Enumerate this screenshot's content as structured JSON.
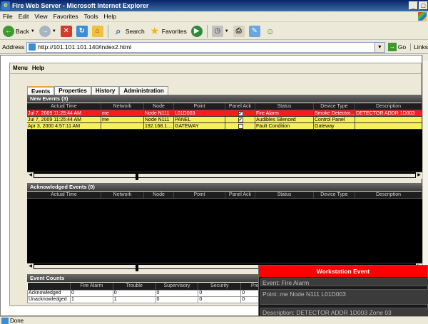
{
  "window": {
    "title": "Fire Web Server - Microsoft Internet Explorer",
    "controls": [
      "_",
      "□"
    ]
  },
  "menu": [
    "File",
    "Edit",
    "View",
    "Favorites",
    "Tools",
    "Help"
  ],
  "toolbar": {
    "back_label": "Back",
    "search_label": "Search",
    "favorites_label": "Favorites"
  },
  "address": {
    "label": "Address",
    "url": "http://101.101.101.140/index2.html",
    "go_label": "Go",
    "links_label": "Links"
  },
  "app": {
    "menu": [
      "Menu",
      "Help"
    ],
    "tabs": [
      "Events",
      "Properties",
      "History",
      "Administration"
    ],
    "active_tab": "Events"
  },
  "columns": [
    "Actual Time",
    "Network",
    "Node",
    "Point",
    "Panel Ack",
    "Status",
    "Device Type",
    "Description"
  ],
  "new_events": {
    "header": "New Events (3)",
    "rows": [
      {
        "time": "Jul 7, 2009 11:25:44 AM",
        "network": "me",
        "node": "Node N111",
        "point": "L01D003",
        "ack": "✔",
        "status": "Fire Alarm",
        "device": "Smoke Detector...",
        "description": "DETECTOR ADDR 1D003",
        "color": "#ff1a1a"
      },
      {
        "time": "Jul 7, 2009 11:25:44 AM",
        "network": "me",
        "node": "Node N111",
        "point": "PANEL",
        "ack": "✔",
        "status": "Audibles Silenced",
        "device": "Control Panel",
        "description": "",
        "color": "#f6f15a"
      },
      {
        "time": "Apr 3, 2000 4:57:11 AM",
        "network": "",
        "node": "192.168.1....",
        "point": "GATEWAY",
        "ack": "",
        "status": "Fault Condition",
        "device": "Gateway",
        "description": "",
        "color": "#f6f15a"
      }
    ]
  },
  "ack_events": {
    "header": "Acknowledged Events (0)",
    "rows": []
  },
  "event_counts": {
    "header": "Event Counts",
    "columns": [
      "",
      "Fire Alarm",
      "Trouble",
      "Supervisory",
      "Security",
      "Pre-Alarm"
    ],
    "rows": [
      {
        "label": "Acknowledged",
        "values": [
          "0",
          "0",
          "0",
          "0",
          "0"
        ]
      },
      {
        "label": "Unacknowledged",
        "values": [
          "1",
          "1",
          "0",
          "0",
          "0"
        ]
      }
    ]
  },
  "popup": {
    "title": "Workstation Event",
    "event": "Event: Fire Alarm",
    "point": "Point: me Node N111 L01D003",
    "description": "Description: DETECTOR ADDR 1D003  Zone 03"
  },
  "status": {
    "text": "Done"
  }
}
